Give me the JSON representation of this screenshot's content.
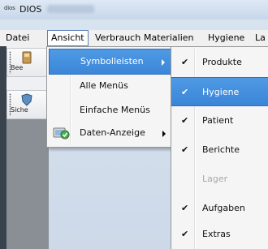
{
  "window": {
    "icon_text": "dios",
    "title": "DIOS"
  },
  "menubar": [
    {
      "label": "Datei"
    },
    {
      "label": "Ansicht"
    },
    {
      "label": "Verbrauch"
    },
    {
      "label": "Materialien"
    },
    {
      "label": "Hygiene"
    },
    {
      "label": "La"
    }
  ],
  "toolbars": [
    {
      "label": "Bee"
    },
    {
      "label": "Siche"
    }
  ],
  "ansicht_menu": {
    "items": [
      {
        "label": "Symbolleisten",
        "has_submenu": true,
        "highlighted": true
      },
      {
        "label": "Alle Menüs"
      },
      {
        "label": "Einfache Menüs"
      },
      {
        "label": "Daten-Anzeige",
        "has_submenu": true,
        "icon": "data-display-icon"
      }
    ]
  },
  "symbolleisten_submenu": {
    "check_glyph": "✔",
    "items": [
      {
        "label": "Produkte",
        "checked": true
      },
      {
        "label": "Hygiene",
        "checked": true,
        "highlighted": true
      },
      {
        "label": "Patient",
        "checked": true
      },
      {
        "label": "Berichte",
        "checked": true
      },
      {
        "label": "Lager",
        "checked": false,
        "disabled": true
      },
      {
        "label": "Aufgaben",
        "checked": true
      },
      {
        "label": "Extras",
        "checked": true
      }
    ]
  },
  "colors": {
    "highlight": "#3b86d8",
    "menu_bg": "#f5f5f5"
  }
}
